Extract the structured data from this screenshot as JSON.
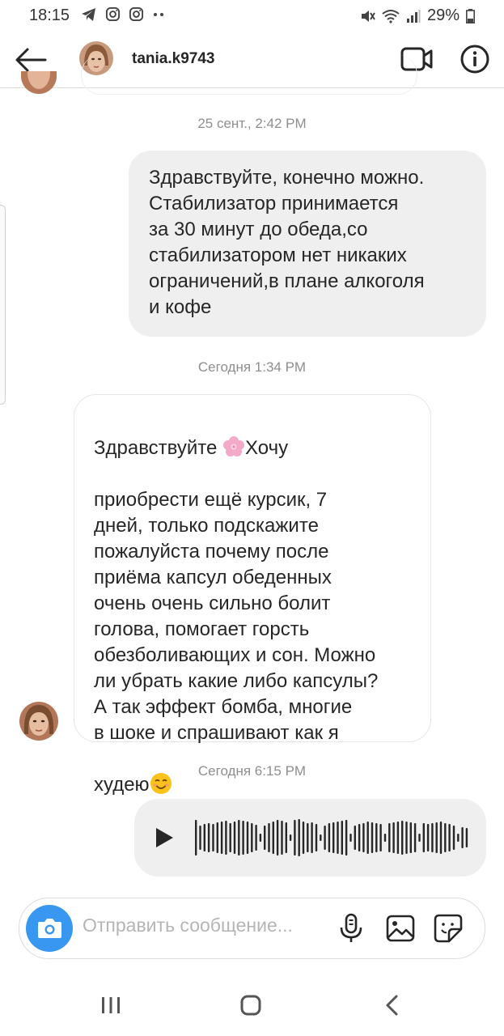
{
  "status_bar": {
    "time": "18:15",
    "battery": "29%",
    "icons_left": [
      "telegram-icon",
      "instagram-icon",
      "instagram-icon",
      "more-dots-icon"
    ],
    "icons_right": [
      "mute-icon",
      "wifi-icon",
      "signal-icon",
      "battery-icon"
    ]
  },
  "header": {
    "username": "tania.k9743",
    "icons": [
      "back-arrow-icon",
      "video-call-icon",
      "info-icon"
    ]
  },
  "messages": [
    {
      "type": "timestamp",
      "text": "25 сент., 2:42 PM"
    },
    {
      "type": "outgoing",
      "text": "Здравствуйте, конечно можно.\nСтабилизатор принимается\nза 30 минут до обеда,со\nстабилизатором нет никаких\nограничений,в плане алкоголя\nи кофе"
    },
    {
      "type": "timestamp",
      "text": "Сегодня 1:34 PM"
    },
    {
      "type": "incoming",
      "text_line1_before_emoji": "Здравствуйте ",
      "emoji1": "flower-emoji",
      "text_line1_after_emoji": "Хочу",
      "text_body": "приобрести ещё курсик, 7\nдней, только подскажите\nпожалуйста почему после\nприёма капсул обеденных\nочень очень сильно болит\nголова, помогает горсть\nобезболивающих и сон. Можно\nли убрать какие либо капсулы?\nА так эффект бомба, многие\nв шоке и спрашивают как я",
      "text_last": "худею",
      "emoji2": "smiling-face-emoji"
    },
    {
      "type": "timestamp",
      "text": "Сегодня 6:15 PM"
    },
    {
      "type": "voice",
      "icon": "play-icon"
    }
  ],
  "composer": {
    "placeholder": "Отправить сообщение...",
    "icons": [
      "camera-icon",
      "microphone-icon",
      "gallery-icon",
      "sticker-icon"
    ]
  },
  "nav_bar": {
    "icons": [
      "recents-icon",
      "home-icon",
      "nav-back-icon"
    ]
  },
  "colors": {
    "accent": "#3897f0",
    "bubble_outgoing": "#efefef",
    "timestamp_text": "#8e8e8e"
  }
}
